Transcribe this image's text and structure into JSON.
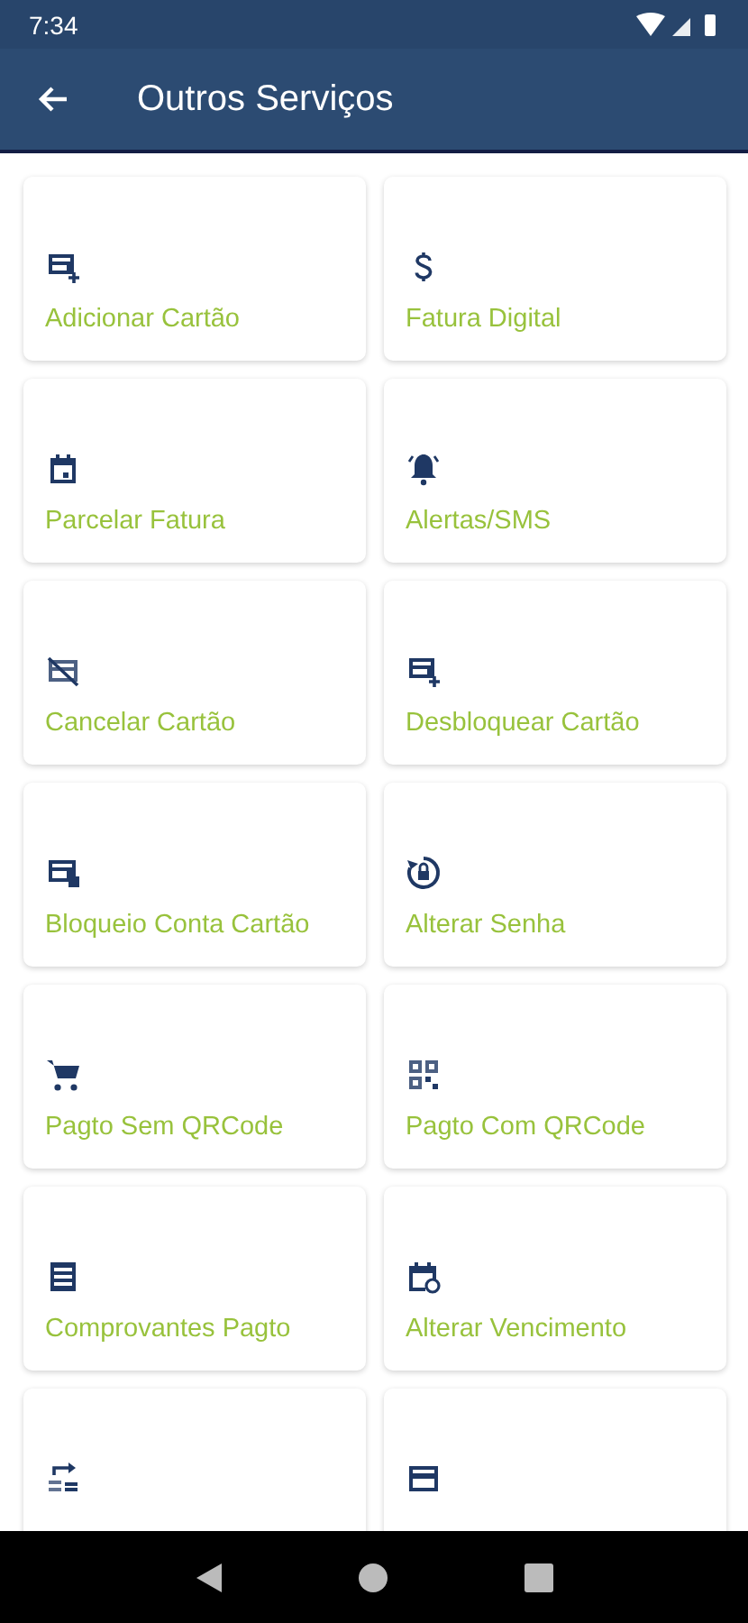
{
  "status_bar": {
    "time": "7:34"
  },
  "app_bar": {
    "title": "Outros Serviços"
  },
  "services": [
    {
      "kind": "card-add",
      "label": "Adicionar Cartão"
    },
    {
      "kind": "dollar",
      "label": "Fatura Digital"
    },
    {
      "kind": "calendar",
      "label": "Parcelar Fatura"
    },
    {
      "kind": "bell",
      "label": "Alertas/SMS"
    },
    {
      "kind": "card-off",
      "label": "Cancelar Cartão"
    },
    {
      "kind": "card-add",
      "label": "Desbloquear Cartão"
    },
    {
      "kind": "card-lock",
      "label": "Bloqueio Conta Cartão"
    },
    {
      "kind": "lock-reset",
      "label": "Alterar Senha"
    },
    {
      "kind": "cart",
      "label": "Pagto Sem QRCode"
    },
    {
      "kind": "qr",
      "label": "Pagto Com QRCode"
    },
    {
      "kind": "list",
      "label": "Comprovantes Pagto"
    },
    {
      "kind": "calendar-clock",
      "label": "Alterar Vencimento"
    },
    {
      "kind": "transfer"
    },
    {
      "kind": "card"
    }
  ]
}
